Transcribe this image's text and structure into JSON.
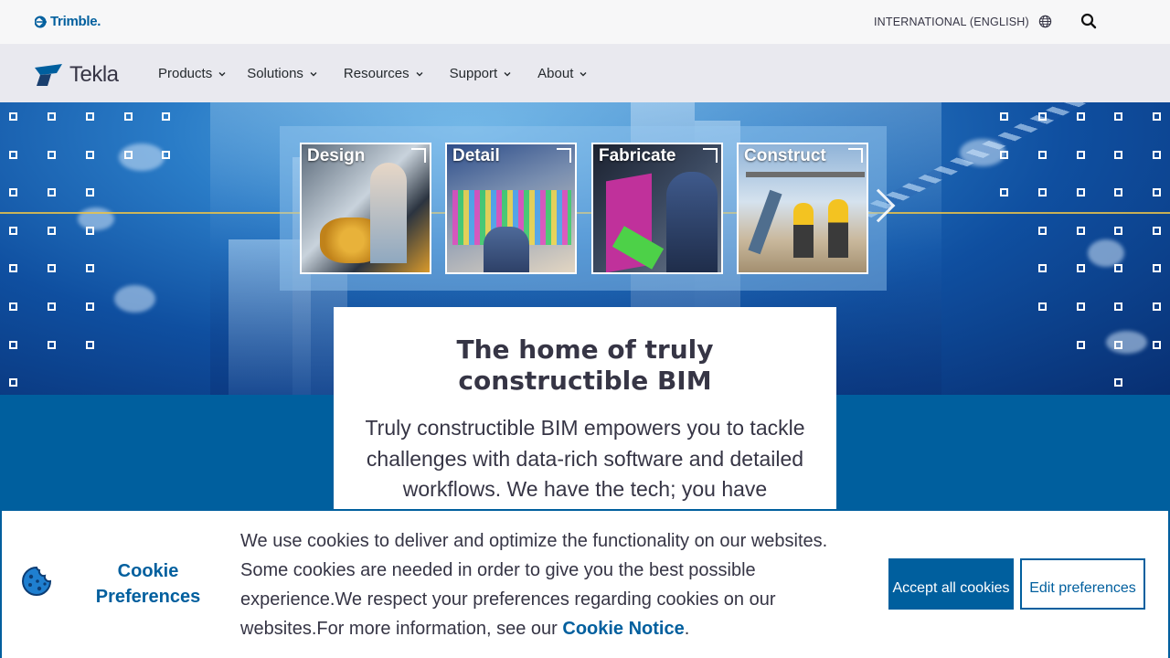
{
  "topbar": {
    "brand": "Trimble.",
    "language": "INTERNATIONAL (ENGLISH)"
  },
  "navbar": {
    "logo_text": "Tekla",
    "items": [
      {
        "label": "Products"
      },
      {
        "label": "Solutions"
      },
      {
        "label": "Resources"
      },
      {
        "label": "Support"
      },
      {
        "label": "About"
      }
    ]
  },
  "hero": {
    "tiles": [
      {
        "label": "Design"
      },
      {
        "label": "Detail"
      },
      {
        "label": "Fabricate"
      },
      {
        "label": "Construct"
      }
    ]
  },
  "card": {
    "title": "The home of truly constructible BIM",
    "body": "Truly constructible BIM empowers you to tackle challenges with data-rich software and detailed workflows. We have the tech; you have"
  },
  "cookie": {
    "title": "Cookie Preferences",
    "text": "We use cookies to deliver and optimize the functionality on our websites. Some cookies are needed in order to give you the best possible experience.We respect your preferences regarding cookies on our websites.For more information, see our ",
    "link": "Cookie Notice",
    "text_end": ".",
    "accept_label": "Accept all cookies",
    "edit_label": "Edit preferences"
  },
  "colors": {
    "brand_blue": "#005f9e",
    "text_dark": "#363545"
  }
}
